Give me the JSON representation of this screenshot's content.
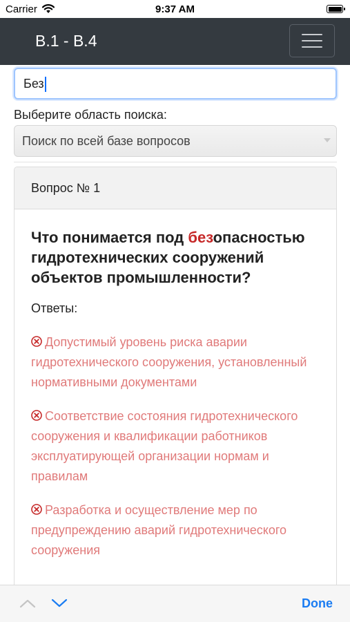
{
  "status_bar": {
    "carrier": "Carrier",
    "time": "9:37 AM"
  },
  "navbar": {
    "title": "B.1 - B.4"
  },
  "search": {
    "value": "Без"
  },
  "search_scope": {
    "label": "Выберите область поиска:",
    "selected": "Поиск по всей базе вопросов"
  },
  "question": {
    "header": "Вопрос № 1",
    "highlight": "без",
    "text_rest": "опасностью гидротехнических сооружений объектов промышленности?",
    "text_prefix": "Что понимается под ",
    "answers_label": "Ответы:",
    "answers": [
      {
        "text": "Допустимый уровень риска аварии гидротехнического сооружения, установленный нормативными документами"
      },
      {
        "text": "Соответствие состояния гидротехнического сооружения и квалификации работников эксплуатирующей организации нормам и правилам"
      },
      {
        "text": "Разработка и осуществление мер по предупреждению аварий гидротехнического сооружения"
      }
    ]
  },
  "keyboard_toolbar": {
    "done_label": "Done"
  },
  "colors": {
    "navbar": "#343a40",
    "highlight": "#c62828",
    "wrong_answer": "#e07a7a",
    "accent": "#1a7cf2"
  }
}
